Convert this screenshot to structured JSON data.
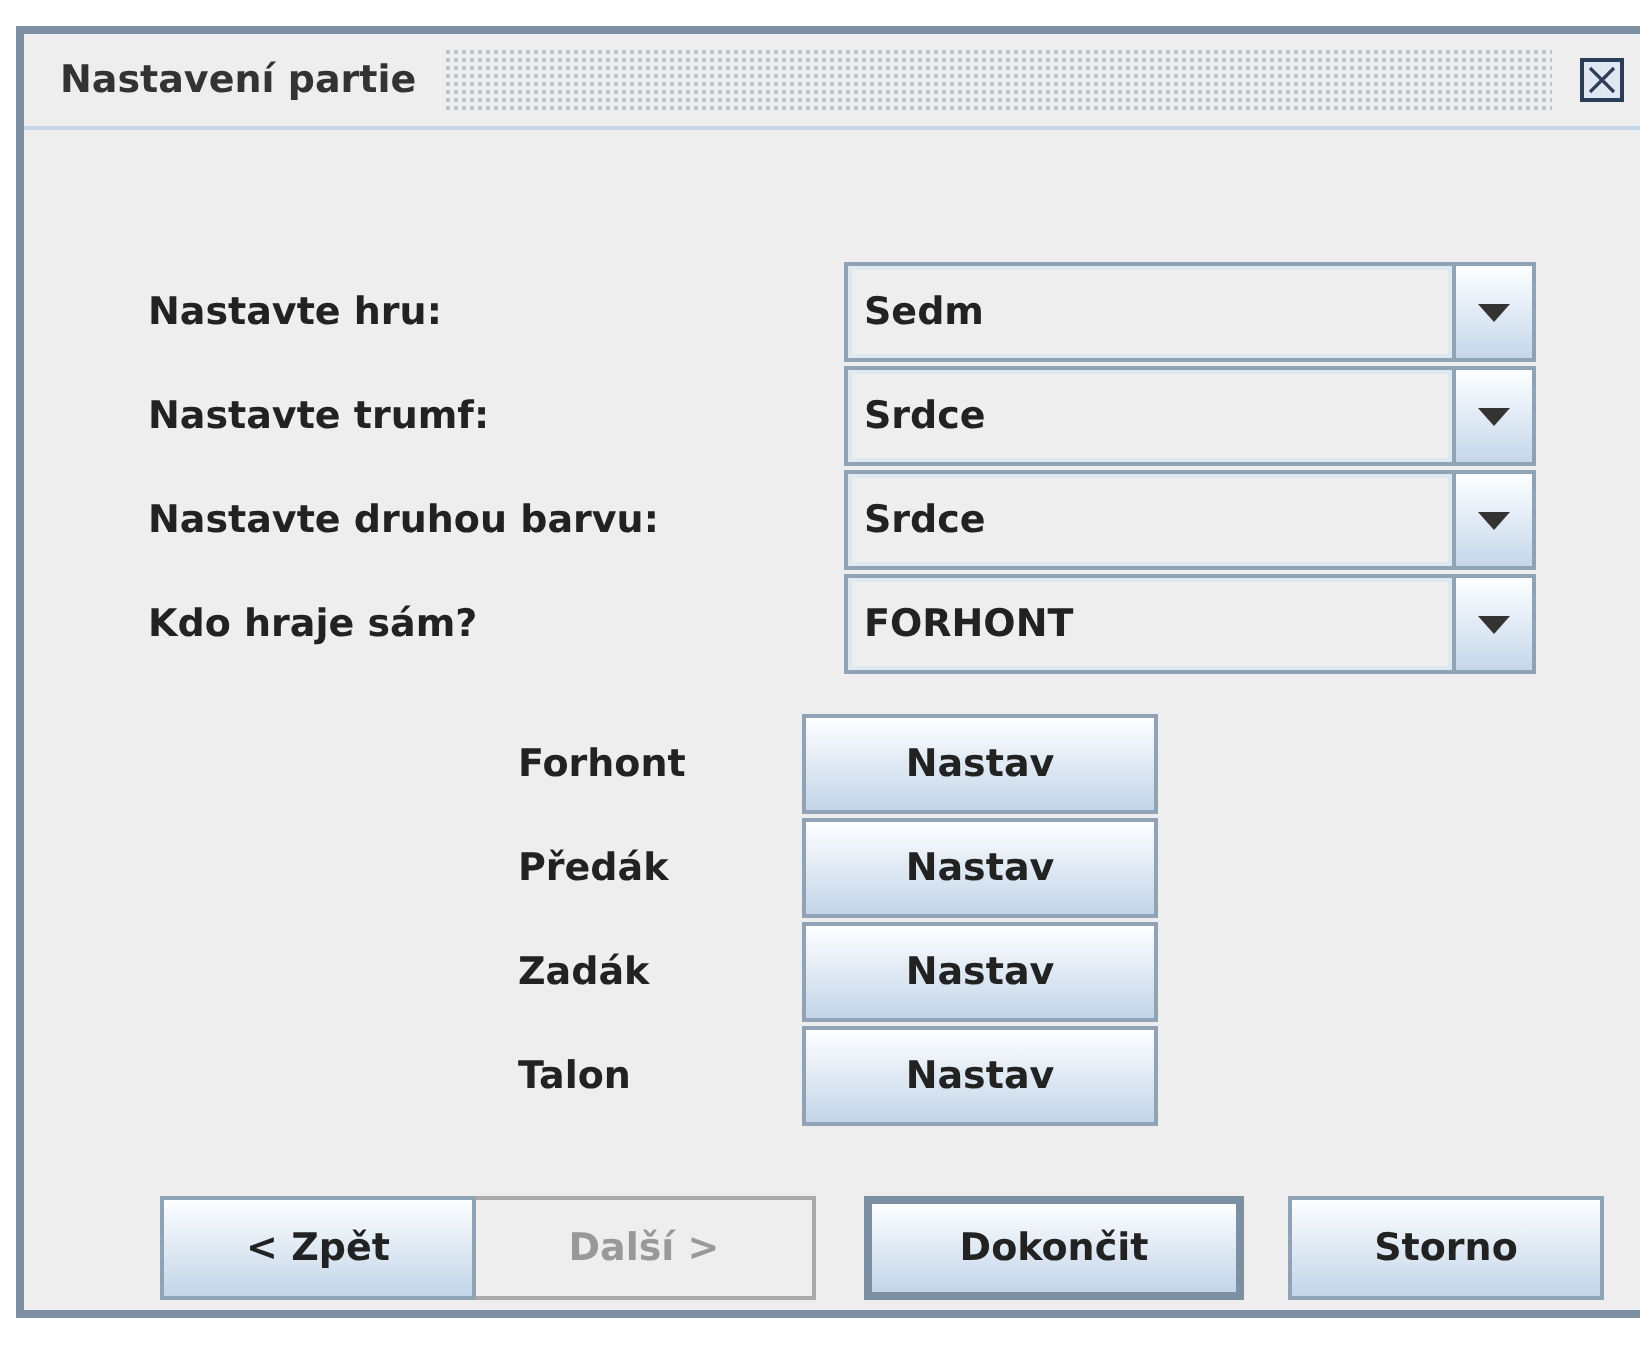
{
  "window": {
    "title": "Nastavení partie"
  },
  "settings": [
    {
      "label": "Nastavte hru:",
      "value": "Sedm"
    },
    {
      "label": "Nastavte trumf:",
      "value": "Srdce"
    },
    {
      "label": "Nastavte druhou barvu:",
      "value": "Srdce"
    },
    {
      "label": "Kdo hraje sám?",
      "value": "FORHONT"
    }
  ],
  "players": [
    {
      "label": "Forhont",
      "button": "Nastav"
    },
    {
      "label": "Předák",
      "button": "Nastav"
    },
    {
      "label": "Zadák",
      "button": "Nastav"
    },
    {
      "label": "Talon",
      "button": "Nastav"
    }
  ],
  "buttons": [
    {
      "label": "< Zpět",
      "disabled": false,
      "default": false
    },
    {
      "label": "Další >",
      "disabled": true,
      "default": false
    },
    {
      "label": "Dokončit",
      "disabled": false,
      "default": true
    },
    {
      "label": "Storno",
      "disabled": false,
      "default": false
    }
  ]
}
